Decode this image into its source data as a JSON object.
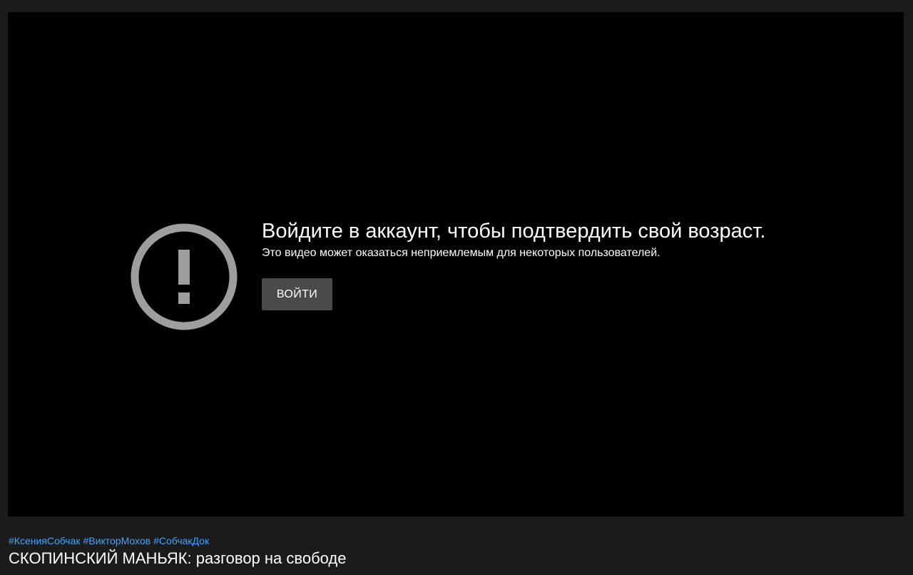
{
  "player": {
    "warning_icon": "exclamation-circle-icon",
    "title": "Войдите в аккаунт, чтобы подтвердить свой возраст.",
    "subtitle": "Это видео может оказаться неприемлемым для некоторых пользователей.",
    "signin_label": "ВОЙТИ"
  },
  "video": {
    "hashtags": [
      "#КсенияСобчак",
      "#ВикторМохов",
      "#СобчакДок"
    ],
    "title": "СКОПИНСКИЙ МАНЬЯК: разговор на свободе"
  },
  "colors": {
    "background": "#1b1b1b",
    "player_background": "#000000",
    "icon": "#9e9e9e",
    "button": "#4a4a4a",
    "hashtag": "#3ea6ff"
  }
}
